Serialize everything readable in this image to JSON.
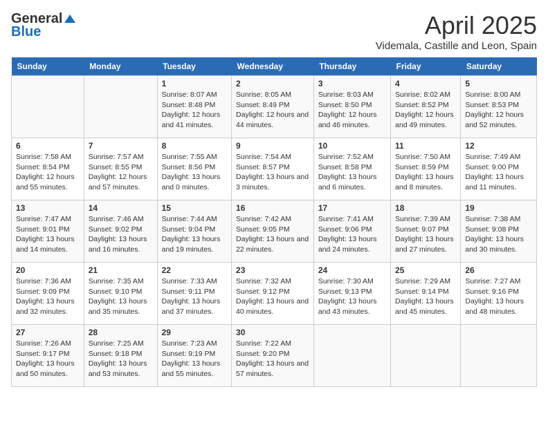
{
  "logo": {
    "general": "General",
    "blue": "Blue"
  },
  "title": "April 2025",
  "subtitle": "Videmala, Castille and Leon, Spain",
  "headers": [
    "Sunday",
    "Monday",
    "Tuesday",
    "Wednesday",
    "Thursday",
    "Friday",
    "Saturday"
  ],
  "weeks": [
    [
      {
        "day": "",
        "info": ""
      },
      {
        "day": "",
        "info": ""
      },
      {
        "day": "1",
        "info": "Sunrise: 8:07 AM\nSunset: 8:48 PM\nDaylight: 12 hours and 41 minutes."
      },
      {
        "day": "2",
        "info": "Sunrise: 8:05 AM\nSunset: 8:49 PM\nDaylight: 12 hours and 44 minutes."
      },
      {
        "day": "3",
        "info": "Sunrise: 8:03 AM\nSunset: 8:50 PM\nDaylight: 12 hours and 46 minutes."
      },
      {
        "day": "4",
        "info": "Sunrise: 8:02 AM\nSunset: 8:52 PM\nDaylight: 12 hours and 49 minutes."
      },
      {
        "day": "5",
        "info": "Sunrise: 8:00 AM\nSunset: 8:53 PM\nDaylight: 12 hours and 52 minutes."
      }
    ],
    [
      {
        "day": "6",
        "info": "Sunrise: 7:58 AM\nSunset: 8:54 PM\nDaylight: 12 hours and 55 minutes."
      },
      {
        "day": "7",
        "info": "Sunrise: 7:57 AM\nSunset: 8:55 PM\nDaylight: 12 hours and 57 minutes."
      },
      {
        "day": "8",
        "info": "Sunrise: 7:55 AM\nSunset: 8:56 PM\nDaylight: 13 hours and 0 minutes."
      },
      {
        "day": "9",
        "info": "Sunrise: 7:54 AM\nSunset: 8:57 PM\nDaylight: 13 hours and 3 minutes."
      },
      {
        "day": "10",
        "info": "Sunrise: 7:52 AM\nSunset: 8:58 PM\nDaylight: 13 hours and 6 minutes."
      },
      {
        "day": "11",
        "info": "Sunrise: 7:50 AM\nSunset: 8:59 PM\nDaylight: 13 hours and 8 minutes."
      },
      {
        "day": "12",
        "info": "Sunrise: 7:49 AM\nSunset: 9:00 PM\nDaylight: 13 hours and 11 minutes."
      }
    ],
    [
      {
        "day": "13",
        "info": "Sunrise: 7:47 AM\nSunset: 9:01 PM\nDaylight: 13 hours and 14 minutes."
      },
      {
        "day": "14",
        "info": "Sunrise: 7:46 AM\nSunset: 9:02 PM\nDaylight: 13 hours and 16 minutes."
      },
      {
        "day": "15",
        "info": "Sunrise: 7:44 AM\nSunset: 9:04 PM\nDaylight: 13 hours and 19 minutes."
      },
      {
        "day": "16",
        "info": "Sunrise: 7:42 AM\nSunset: 9:05 PM\nDaylight: 13 hours and 22 minutes."
      },
      {
        "day": "17",
        "info": "Sunrise: 7:41 AM\nSunset: 9:06 PM\nDaylight: 13 hours and 24 minutes."
      },
      {
        "day": "18",
        "info": "Sunrise: 7:39 AM\nSunset: 9:07 PM\nDaylight: 13 hours and 27 minutes."
      },
      {
        "day": "19",
        "info": "Sunrise: 7:38 AM\nSunset: 9:08 PM\nDaylight: 13 hours and 30 minutes."
      }
    ],
    [
      {
        "day": "20",
        "info": "Sunrise: 7:36 AM\nSunset: 9:09 PM\nDaylight: 13 hours and 32 minutes."
      },
      {
        "day": "21",
        "info": "Sunrise: 7:35 AM\nSunset: 9:10 PM\nDaylight: 13 hours and 35 minutes."
      },
      {
        "day": "22",
        "info": "Sunrise: 7:33 AM\nSunset: 9:11 PM\nDaylight: 13 hours and 37 minutes."
      },
      {
        "day": "23",
        "info": "Sunrise: 7:32 AM\nSunset: 9:12 PM\nDaylight: 13 hours and 40 minutes."
      },
      {
        "day": "24",
        "info": "Sunrise: 7:30 AM\nSunset: 9:13 PM\nDaylight: 13 hours and 43 minutes."
      },
      {
        "day": "25",
        "info": "Sunrise: 7:29 AM\nSunset: 9:14 PM\nDaylight: 13 hours and 45 minutes."
      },
      {
        "day": "26",
        "info": "Sunrise: 7:27 AM\nSunset: 9:16 PM\nDaylight: 13 hours and 48 minutes."
      }
    ],
    [
      {
        "day": "27",
        "info": "Sunrise: 7:26 AM\nSunset: 9:17 PM\nDaylight: 13 hours and 50 minutes."
      },
      {
        "day": "28",
        "info": "Sunrise: 7:25 AM\nSunset: 9:18 PM\nDaylight: 13 hours and 53 minutes."
      },
      {
        "day": "29",
        "info": "Sunrise: 7:23 AM\nSunset: 9:19 PM\nDaylight: 13 hours and 55 minutes."
      },
      {
        "day": "30",
        "info": "Sunrise: 7:22 AM\nSunset: 9:20 PM\nDaylight: 13 hours and 57 minutes."
      },
      {
        "day": "",
        "info": ""
      },
      {
        "day": "",
        "info": ""
      },
      {
        "day": "",
        "info": ""
      }
    ]
  ]
}
